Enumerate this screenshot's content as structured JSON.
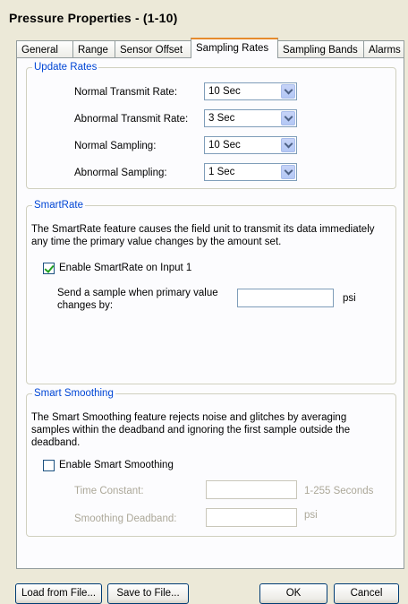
{
  "window": {
    "title": "Pressure Properties -  (1-10)"
  },
  "tabs": [
    {
      "label": "General"
    },
    {
      "label": "Range"
    },
    {
      "label": "Sensor Offset"
    },
    {
      "label": "Sampling Rates",
      "active": true
    },
    {
      "label": "Sampling Bands"
    },
    {
      "label": "Alarms"
    }
  ],
  "update_rates": {
    "legend": "Update Rates",
    "rows": [
      {
        "label": "Normal Transmit Rate:",
        "value": "10 Sec"
      },
      {
        "label": "Abnormal Transmit Rate:",
        "value": "3 Sec"
      },
      {
        "label": "Normal Sampling:",
        "value": "10 Sec"
      },
      {
        "label": "Abnormal Sampling:",
        "value": "1 Sec"
      }
    ]
  },
  "smartrate": {
    "legend": "SmartRate",
    "description": "The SmartRate feature causes the field unit to transmit its data immediately any time the primary value changes by the amount set.",
    "enable_label": "Enable SmartRate on Input 1",
    "enabled": true,
    "sample_label": "Send a sample when primary value changes by:",
    "sample_value": "",
    "unit": "psi"
  },
  "smart_smoothing": {
    "legend": "Smart Smoothing",
    "description": "The Smart Smoothing feature rejects noise and glitches by averaging samples within the deadband and ignoring the first sample outside the deadband.",
    "enable_label": "Enable Smart Smoothing",
    "enabled": false,
    "time_constant_label": "Time Constant:",
    "time_constant_value": "",
    "time_constant_unit": "1-255 Seconds",
    "deadband_label": "Smoothing Deadband:",
    "deadband_value": "",
    "deadband_unit": "psi"
  },
  "footer": {
    "load": "Load from File...",
    "save": "Save to File...",
    "ok": "OK",
    "cancel": "Cancel"
  }
}
